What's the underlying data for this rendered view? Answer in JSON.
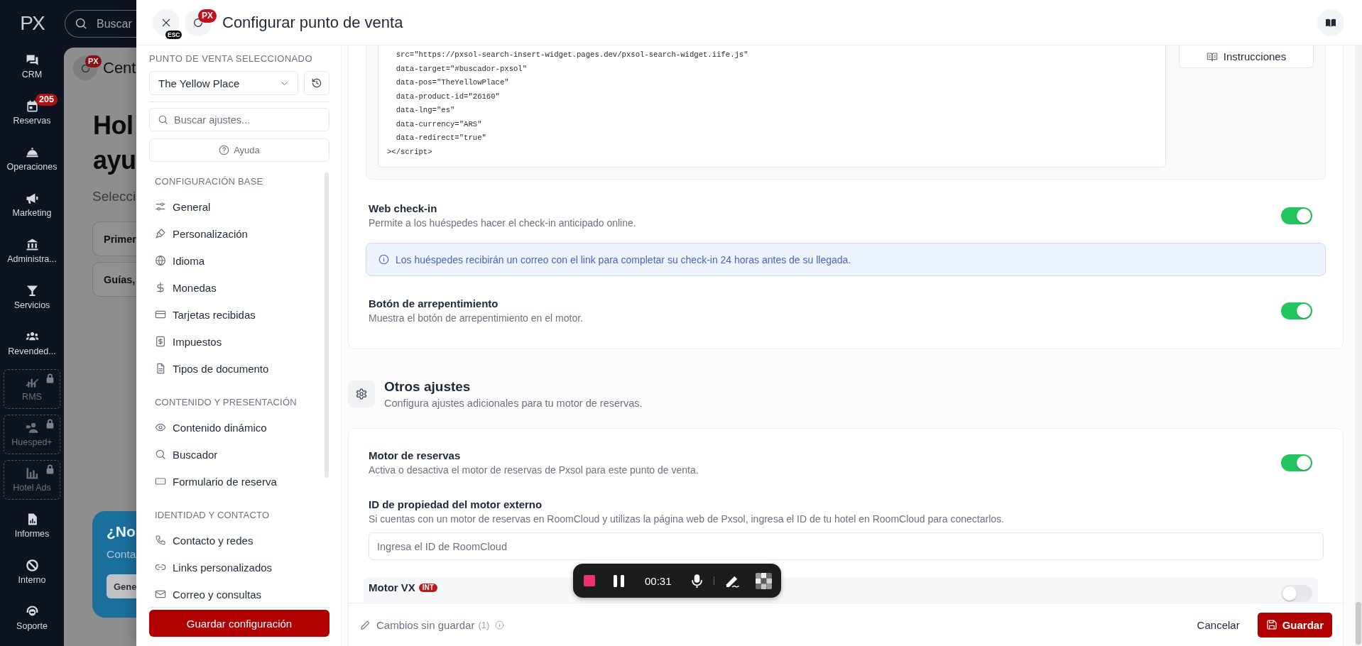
{
  "app_nav": {
    "logo": "PX",
    "items": [
      {
        "label": "CRM",
        "locked": false
      },
      {
        "label": "Reservas",
        "locked": false,
        "badge": "205"
      },
      {
        "label": "Operaciones",
        "locked": false
      },
      {
        "label": "Marketing",
        "locked": false
      },
      {
        "label": "Administra...",
        "locked": false
      },
      {
        "label": "Servicios",
        "locked": false
      },
      {
        "label": "Revended...",
        "locked": false
      },
      {
        "label": "RMS",
        "locked": true
      },
      {
        "label": "Huesped+",
        "locked": true
      },
      {
        "label": "Hotel Ads",
        "locked": true
      },
      {
        "label": "Informes",
        "locked": false
      },
      {
        "label": "Interno",
        "locked": false
      },
      {
        "label": "Soporte",
        "locked": false
      }
    ]
  },
  "background_page": {
    "search": {
      "placeholder": "Buscar"
    },
    "header_badge": "PX",
    "header_title": "Cent",
    "heading_lines": [
      "Hol",
      "ayu"
    ],
    "subtitle": "Selecci",
    "cards": [
      "Primer",
      "Guías,"
    ],
    "promo": {
      "title": "¿No",
      "text": "Conta",
      "button": "Gene"
    }
  },
  "drawer": {
    "close_badge": "ESC",
    "history_badge": "PX",
    "title": "Configurar punto de venta"
  },
  "sidebar": {
    "pos_label": "PUNTO DE VENTA SELECCIONADO",
    "pos_value": "The Yellow Place",
    "search": {
      "placeholder": "Buscar ajustes..."
    },
    "help_button": "Ayuda",
    "sections": [
      {
        "title": "CONFIGURACIÓN BASE",
        "items": [
          "General",
          "Personalización",
          "Idioma",
          "Monedas",
          "Tarjetas recibidas",
          "Impuestos",
          "Tipos de documento"
        ]
      },
      {
        "title": "CONTENIDO Y PRESENTACIÓN",
        "items": [
          "Contenido dinámico",
          "Buscador",
          "Formulario de reserva"
        ]
      },
      {
        "title": "IDENTIDAD Y CONTACTO",
        "items": [
          "Contacto y redes",
          "Links personalizados",
          "Correo y consultas"
        ]
      }
    ],
    "save_button": "Guardar configuración"
  },
  "engine_card": {
    "code_lines": [
      "  src=\"https://pxsol-search-insert-widget.pages.dev/pxsol-search-widget.iife.js\"",
      "  data-target=\"#buscador-pxsol\"",
      "  data-pos=\"TheYellowPlace\"",
      "  data-product-id=\"26160\"",
      "  data-lng=\"es\"",
      "  data-currency=\"ARS\"",
      "  data-redirect=\"true\"",
      "></script>"
    ],
    "instructions_button": "Instrucciones",
    "rows": [
      {
        "kind": "toggle",
        "title": "Web check-in",
        "description": "Permite a los huéspedes hacer el check-in anticipado online.",
        "on": true
      },
      {
        "kind": "info",
        "text": "Los huéspedes recibirán un correo con el link para completar su check-in 24 horas antes de su llegada."
      },
      {
        "kind": "toggle",
        "title": "Botón de arrepentimiento",
        "description": "Muestra el botón de arrepentimiento en el motor.",
        "on": true
      }
    ]
  },
  "other_settings": {
    "title": "Otros ajustes",
    "description": "Configura ajustes adicionales para tu motor de reservas.",
    "rows": [
      {
        "kind": "toggle",
        "title": "Motor de reservas",
        "description": "Activa o desactiva el motor de reservas de Pxsol para este punto de venta.",
        "on": true,
        "highlighted": false
      },
      {
        "kind": "input",
        "title": "ID de propiedad del motor externo",
        "description": "Si cuentas con un motor de reservas en RoomCloud y utilizas la página web de Pxsol, ingresa el ID de tu hotel en RoomCloud para conectarlos.",
        "placeholder": "Ingresa el ID de RoomCloud",
        "highlighted": false
      },
      {
        "kind": "toggle",
        "title": "Motor VX",
        "badge": "INT",
        "on": false,
        "highlighted": true
      }
    ]
  },
  "footer": {
    "unsaved_label": "Cambios sin guardar",
    "unsaved_count": "(1)",
    "cancel_button": "Cancelar",
    "save_button": "Guardar"
  },
  "recorder": {
    "time": "00:31"
  }
}
